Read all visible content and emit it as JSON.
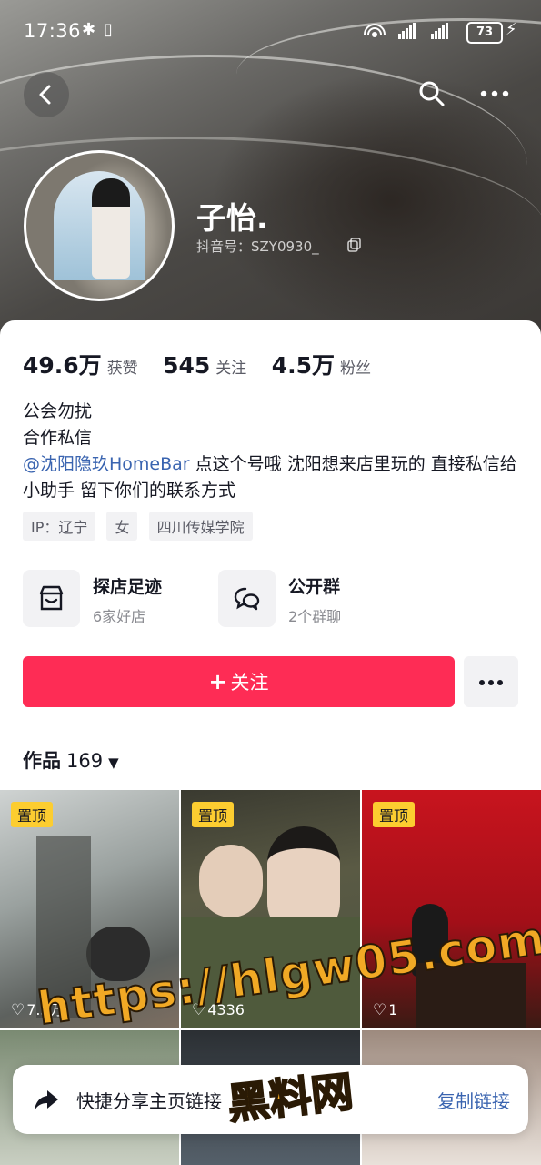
{
  "status_bar": {
    "time": "17:36",
    "battery": "73"
  },
  "profile": {
    "name": "子怡.",
    "douyin_id": "抖音号：SZY0930_",
    "stats": [
      {
        "value": "49.6万",
        "label": "获赞"
      },
      {
        "value": "545",
        "label": "关注"
      },
      {
        "value": "4.5万",
        "label": "粉丝"
      }
    ],
    "bio": {
      "line1": "公会勿扰",
      "line2": "合作私信",
      "mention": "@沈阳隐玖HomeBar",
      "line3_rest": " 点这个号哦 沈阳想来店里玩的 直接私信给小助手 留下你们的联系方式"
    },
    "tags": [
      "IP：辽宁",
      "女",
      "四川传媒学院"
    ]
  },
  "features": [
    {
      "title": "探店足迹",
      "subtitle": "6家好店",
      "icon": "shop-icon"
    },
    {
      "title": "公开群",
      "subtitle": "2个群聊",
      "icon": "chat-group-icon"
    }
  ],
  "actions": {
    "follow_label": "关注",
    "follow_icon": "plus-icon"
  },
  "works": {
    "label": "作品",
    "count": "169"
  },
  "grid": [
    {
      "pinned": "置顶",
      "likes": "7.5万"
    },
    {
      "pinned": "置顶",
      "likes": "4336"
    },
    {
      "pinned": "置顶",
      "likes": "1"
    }
  ],
  "share_bar": {
    "text": "快捷分享主页链接",
    "action": "复制链接"
  },
  "watermark": {
    "url": "https://hlgw05.com",
    "name": "黑料网"
  },
  "colors": {
    "accent": "#fe2c55",
    "link": "#3a64b0",
    "pin_badge": "#fccd30"
  }
}
